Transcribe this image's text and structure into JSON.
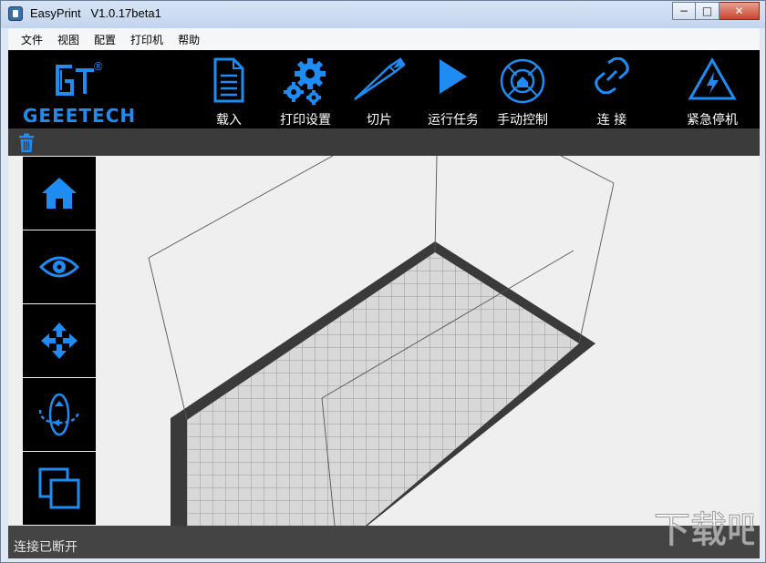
{
  "window": {
    "title": "EasyPrint   V1.0.17beta1",
    "minimize_glyph": "−",
    "maximize_glyph": "□",
    "close_glyph": "✕"
  },
  "menu": [
    "文件",
    "视图",
    "配置",
    "打印机",
    "帮助"
  ],
  "logo": {
    "word": "GEEETECH",
    "reg": "®"
  },
  "toolbar": {
    "load": "载入",
    "print_settings": "打印设置",
    "slice": "切片",
    "run_task": "运行任务",
    "manual_control": "手动控制",
    "connect": "连  接",
    "emergency_stop": "紧急停机"
  },
  "side_tools": [
    "home-icon",
    "eye-icon",
    "move-icon",
    "rotate-icon",
    "copy-icon"
  ],
  "status": {
    "text": "连接已断开"
  },
  "watermark": {
    "text": "下载吧"
  },
  "colors": {
    "accent": "#1e8cf2",
    "toolbar_bg": "#000000",
    "subbar_bg": "#3b3b3b",
    "viewport_bg": "#efefef",
    "status_bg": "#444444"
  }
}
